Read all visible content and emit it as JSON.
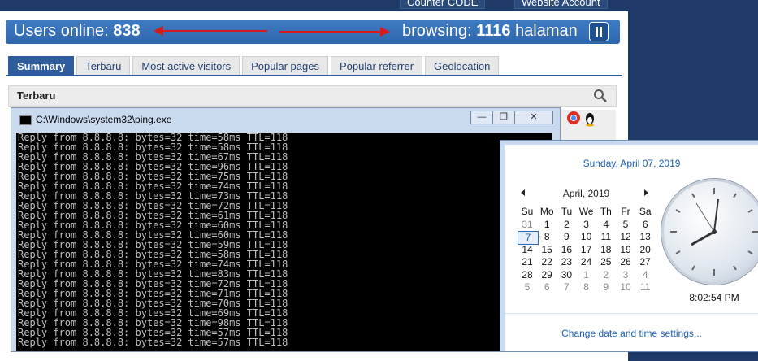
{
  "top_links": [
    "Counter CODE",
    "Website Account"
  ],
  "header": {
    "users_label": "Users online:",
    "users_count": "838",
    "browsing_label": "browsing:",
    "browsing_count": "1116",
    "browsing_unit": "halaman"
  },
  "tabs": [
    "Summary",
    "Terbaru",
    "Most active visitors",
    "Popular pages",
    "Popular referrer",
    "Geolocation"
  ],
  "section_title": "Terbaru",
  "cmd": {
    "title": "C:\\Windows\\system32\\ping.exe",
    "lines": [
      "Reply from 8.8.8.8: bytes=32 time=58ms TTL=118",
      "Reply from 8.8.8.8: bytes=32 time=58ms TTL=118",
      "Reply from 8.8.8.8: bytes=32 time=67ms TTL=118",
      "Reply from 8.8.8.8: bytes=32 time=96ms TTL=118",
      "Reply from 8.8.8.8: bytes=32 time=75ms TTL=118",
      "Reply from 8.8.8.8: bytes=32 time=74ms TTL=118",
      "Reply from 8.8.8.8: bytes=32 time=73ms TTL=118",
      "Reply from 8.8.8.8: bytes=32 time=72ms TTL=118",
      "Reply from 8.8.8.8: bytes=32 time=61ms TTL=118",
      "Reply from 8.8.8.8: bytes=32 time=60ms TTL=118",
      "Reply from 8.8.8.8: bytes=32 time=60ms TTL=118",
      "Reply from 8.8.8.8: bytes=32 time=59ms TTL=118",
      "Reply from 8.8.8.8: bytes=32 time=58ms TTL=118",
      "Reply from 8.8.8.8: bytes=32 time=74ms TTL=118",
      "Reply from 8.8.8.8: bytes=32 time=83ms TTL=118",
      "Reply from 8.8.8.8: bytes=32 time=72ms TTL=118",
      "Reply from 8.8.8.8: bytes=32 time=71ms TTL=118",
      "Reply from 8.8.8.8: bytes=32 time=70ms TTL=118",
      "Reply from 8.8.8.8: bytes=32 time=69ms TTL=118",
      "Reply from 8.8.8.8: bytes=32 time=98ms TTL=118",
      "Reply from 8.8.8.8: bytes=32 time=57ms TTL=118",
      "Reply from 8.8.8.8: bytes=32 time=57ms TTL=118"
    ]
  },
  "calendar": {
    "full_date": "Sunday, April 07, 2019",
    "month_label": "April, 2019",
    "weekdays": [
      "Su",
      "Mo",
      "Tu",
      "We",
      "Th",
      "Fr",
      "Sa"
    ],
    "weeks": [
      [
        "31",
        "1",
        "2",
        "3",
        "4",
        "5",
        "6"
      ],
      [
        "7",
        "8",
        "9",
        "10",
        "11",
        "12",
        "13"
      ],
      [
        "14",
        "15",
        "16",
        "17",
        "18",
        "19",
        "20"
      ],
      [
        "21",
        "22",
        "23",
        "24",
        "25",
        "26",
        "27"
      ],
      [
        "28",
        "29",
        "30",
        "1",
        "2",
        "3",
        "4"
      ],
      [
        "5",
        "6",
        "7",
        "8",
        "9",
        "10",
        "11"
      ]
    ],
    "time": "8:02:54 PM",
    "settings_link": "Change date and time settings..."
  }
}
